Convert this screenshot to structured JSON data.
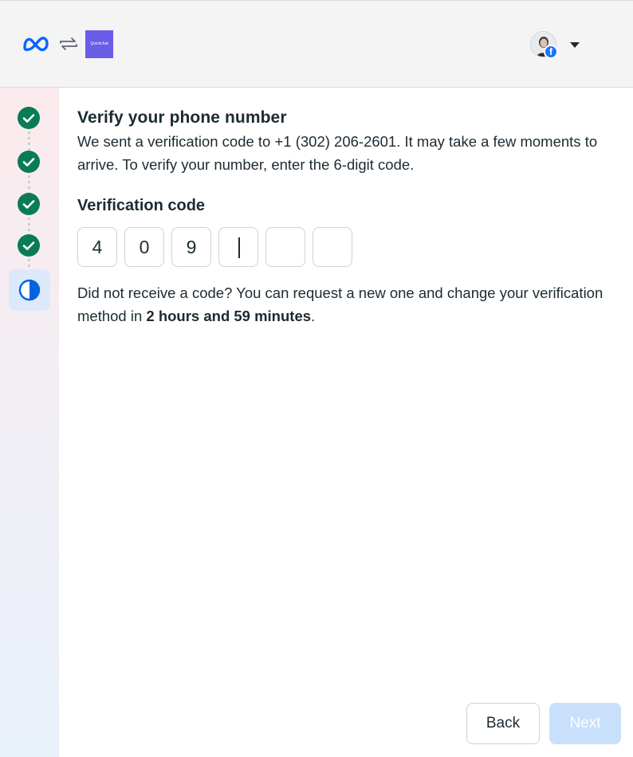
{
  "header": {
    "app_logo_text": "Quickchat",
    "brand_logo": "meta-logo-icon",
    "connect_icon": "swap-arrows-icon",
    "account_badge": "f"
  },
  "steps": [
    {
      "status": "complete",
      "icon": "check-icon"
    },
    {
      "status": "complete",
      "icon": "check-icon"
    },
    {
      "status": "complete",
      "icon": "check-icon"
    },
    {
      "status": "complete",
      "icon": "check-icon"
    },
    {
      "status": "current",
      "icon": "half-circle-icon"
    }
  ],
  "main": {
    "title": "Verify your phone number",
    "description": "We sent a verification code to +1 (302) 206-2601. It may take a few moments to arrive. To verify your number, enter the 6-digit code.",
    "code_label": "Verification code",
    "code_digits": [
      "4",
      "0",
      "9",
      "",
      "",
      ""
    ],
    "resend_prefix": "Did not receive a code? You can request a new one and change your verification method in ",
    "resend_time": "2 hours and 59 minutes",
    "resend_suffix": "."
  },
  "footer": {
    "back_label": "Back",
    "next_label": "Next"
  },
  "colors": {
    "step_complete": "#0a7c55",
    "step_current": "#0064e0",
    "next_disabled": "#c9e0fc",
    "facebook_blue": "#1877f2",
    "app_logo_bg": "#6a5de8"
  }
}
